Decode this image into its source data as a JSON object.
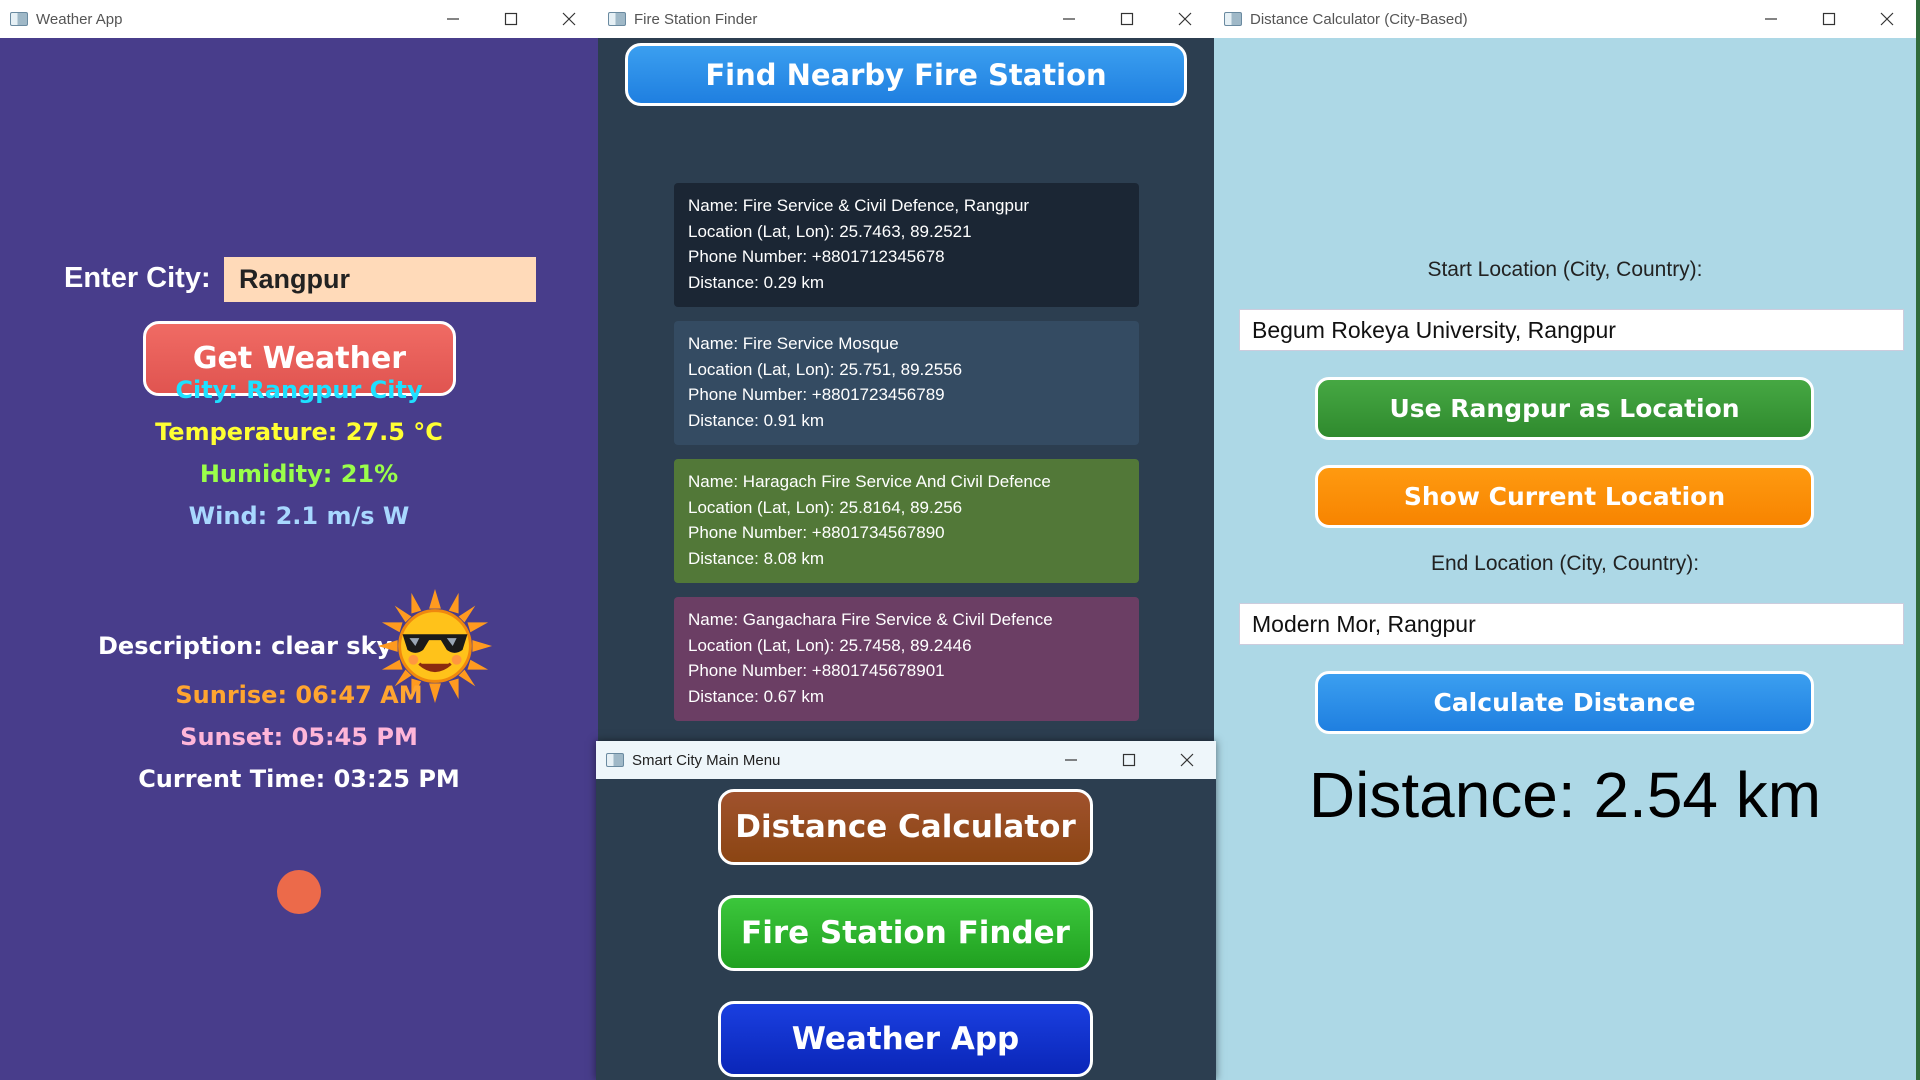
{
  "weather_window": {
    "title": "Weather App",
    "city_label": "Enter City:",
    "city_value": "Rangpur",
    "get_weather_label": "Get Weather",
    "city_line": "City: Rangpur City",
    "temperature_line": "Temperature: 27.5 °C",
    "humidity_line": "Humidity: 21%",
    "wind_line": "Wind: 2.1 m/s W",
    "description_line": "Description: clear sky",
    "weather_icon": "sun-with-sunglasses-icon",
    "sunrise_line": "Sunrise: 06:47 AM",
    "sunset_line": "Sunset: 05:45 PM",
    "current_time_line": "Current Time: 03:25 PM",
    "colors": {
      "city": "#1ee0ff",
      "temperature": "#ffff33",
      "humidity": "#9aff4a",
      "wind": "#a8d8ff",
      "sunrise": "#ffa530",
      "sunset": "#ffb6d9",
      "current_time": "#ffffff"
    }
  },
  "fire_window": {
    "title": "Fire Station Finder",
    "find_button_label": "Find Nearby Fire Station",
    "stations": [
      {
        "name": "Name: Fire Service & Civil Defence, Rangpur",
        "location": "Location (Lat, Lon): 25.7463, 89.2521",
        "phone": "Phone Number: +8801712345678",
        "distance": "Distance: 0.29 km",
        "color": "#1b2634"
      },
      {
        "name": "Name: Fire Service Mosque",
        "location": "Location (Lat, Lon): 25.751, 89.2556",
        "phone": "Phone Number: +8801723456789",
        "distance": "Distance: 0.91 km",
        "color": "#344b62"
      },
      {
        "name": "Name: Haragach Fire Service And Civil Defence",
        "location": "Location (Lat, Lon): 25.8164, 89.256",
        "phone": "Phone Number: +8801734567890",
        "distance": "Distance: 8.08 km",
        "color": "#527838"
      },
      {
        "name": "Name: Gangachara Fire Service & Civil Defence",
        "location": "Location (Lat, Lon): 25.7458, 89.2446",
        "phone": "Phone Number: +8801745678901",
        "distance": "Distance: 0.67 km",
        "color": "#6b3e64"
      }
    ]
  },
  "distance_window": {
    "title": "Distance Calculator (City-Based)",
    "start_label": "Start Location (City, Country):",
    "start_value": "Begum Rokeya University, Rangpur",
    "use_rangpur_label": "Use Rangpur as Location",
    "show_current_label": "Show Current Location",
    "end_label": "End Location (City, Country):",
    "end_value": "Modern Mor, Rangpur",
    "calculate_label": "Calculate Distance",
    "result_text": "Distance: 2.54 km"
  },
  "menu_window": {
    "title": "Smart City Main Menu",
    "distance_button_label": "Distance Calculator",
    "fire_button_label": "Fire Station Finder",
    "weather_button_label": "Weather App"
  }
}
